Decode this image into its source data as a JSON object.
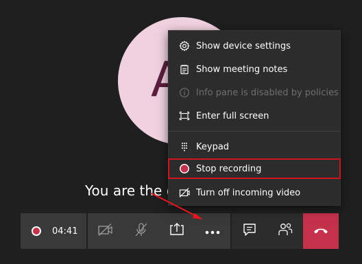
{
  "avatar": {
    "initial": "A"
  },
  "stage": {
    "waiting_text": "You are the only one here"
  },
  "menu": {
    "items": [
      {
        "label": "Show device settings",
        "icon": "gear-icon",
        "disabled": false
      },
      {
        "label": "Show meeting notes",
        "icon": "notes-icon",
        "disabled": false
      },
      {
        "label": "Info pane is disabled by policies",
        "icon": "info-icon",
        "disabled": true
      },
      {
        "label": "Enter full screen",
        "icon": "fullscreen-icon",
        "disabled": false
      },
      {
        "label": "Keypad",
        "icon": "keypad-icon",
        "disabled": false
      },
      {
        "label": "Stop recording",
        "icon": "record-icon",
        "disabled": false,
        "highlighted": true
      },
      {
        "label": "Turn off incoming video",
        "icon": "video-off-icon",
        "disabled": false
      }
    ]
  },
  "toolbar": {
    "recording_time": "04:41",
    "buttons": [
      {
        "icon": "camera-off-icon"
      },
      {
        "icon": "mic-off-icon"
      },
      {
        "icon": "share-screen-icon"
      },
      {
        "icon": "more-options-icon"
      },
      {
        "icon": "chat-icon"
      },
      {
        "icon": "participants-icon"
      },
      {
        "icon": "hang-up-icon"
      }
    ]
  },
  "colors": {
    "background": "#1f1f1f",
    "menu_bg": "#2d2c2c",
    "accent_red": "#c4314b",
    "highlight_border": "#d2131f",
    "avatar_bg": "#f0d1df",
    "avatar_fg": "#5b1f3e"
  }
}
